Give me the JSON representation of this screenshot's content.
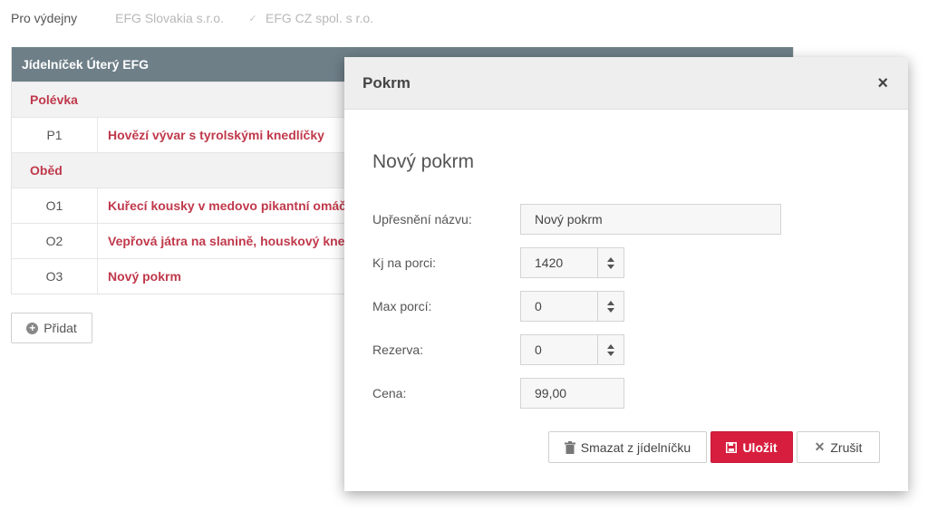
{
  "filters": {
    "label": "Pro výdejny",
    "options": [
      {
        "label": "EFG Slovakia s.r.o.",
        "checked": false
      },
      {
        "label": "EFG CZ spol. s r.o.",
        "checked": true
      }
    ]
  },
  "menu": {
    "title": "Jídelníček Úterý EFG",
    "sections": [
      {
        "name": "Polévka",
        "items": [
          {
            "code": "P1",
            "name": "Hovězí vývar s tyrolskými knedlíčky"
          }
        ]
      },
      {
        "name": "Oběd",
        "items": [
          {
            "code": "O1",
            "name": "Kuřecí kousky v medovo pikantní omáčce"
          },
          {
            "code": "O2",
            "name": "Vepřová játra na slanině, houskový knedlík"
          },
          {
            "code": "O3",
            "name": "Nový pokrm"
          }
        ]
      }
    ],
    "add_label": "Přidat"
  },
  "modal": {
    "title": "Pokrm",
    "close": "×",
    "heading": "Nový pokrm",
    "fields": {
      "name": {
        "label": "Upřesnění názvu:",
        "value": "Nový pokrm"
      },
      "kj": {
        "label": "Kj na porci:",
        "value": "1420"
      },
      "max": {
        "label": "Max porcí:",
        "value": "0"
      },
      "reserve": {
        "label": "Rezerva:",
        "value": "0"
      },
      "price": {
        "label": "Cena:",
        "value": "99,00"
      }
    },
    "buttons": {
      "delete": "Smazat z jídelníčku",
      "save": "Uložit",
      "cancel": "Zrušit"
    }
  },
  "colors": {
    "accent": "#d81e3e",
    "dish_text": "#c0394b",
    "table_header": "#6e7f88"
  }
}
